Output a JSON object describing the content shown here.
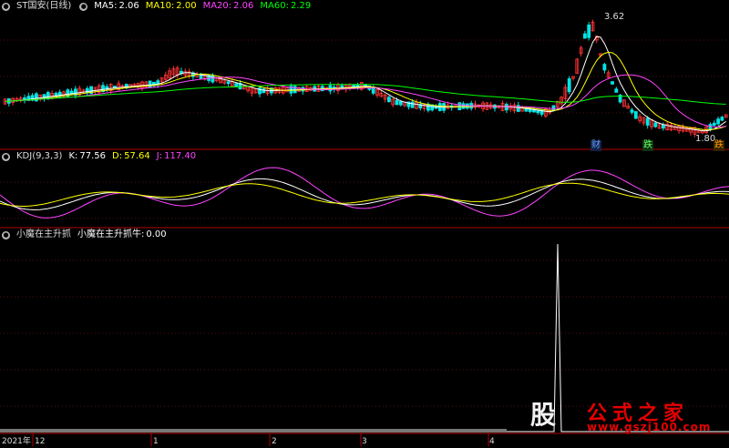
{
  "price_panel": {
    "symbol": "ST国安(日线)",
    "indicators": [
      {
        "label": "MA5:",
        "value": "2.06",
        "color": "#ffffff"
      },
      {
        "label": "MA10:",
        "value": "2.00",
        "color": "#ffff00"
      },
      {
        "label": "MA20:",
        "value": "2.06",
        "color": "#ff44ff"
      },
      {
        "label": "MA60:",
        "value": "2.29",
        "color": "#00ff00"
      }
    ],
    "high_marker": "3.62",
    "low_marker": "1.80",
    "event_tags": [
      {
        "text": "财",
        "color": "#6699ff"
      },
      {
        "text": "跌",
        "color": "#66ff66"
      },
      {
        "text": "跌",
        "color": "#ff9900"
      }
    ]
  },
  "kdj_panel": {
    "name": "KDJ(9,3,3)",
    "indicators": [
      {
        "label": "K:",
        "value": "77.56",
        "color": "#ffffff"
      },
      {
        "label": "D:",
        "value": "57.64",
        "color": "#ffff00"
      },
      {
        "label": "J:",
        "value": "117.40",
        "color": "#ff44ff"
      }
    ]
  },
  "custom_panel": {
    "name": "小魔在主升抓",
    "indicator_label": "小魔在主升抓牛:",
    "indicator_value": "0.00"
  },
  "x_axis": {
    "labels": [
      "2021年",
      "12",
      "1",
      "2",
      "3",
      "4"
    ]
  },
  "watermark": {
    "badge": "股",
    "name": "公式之家",
    "site": "www.gszj100.com"
  },
  "colors": {
    "up": "#ff3333",
    "down": "#00e5e5",
    "separator": "#b30000"
  }
}
